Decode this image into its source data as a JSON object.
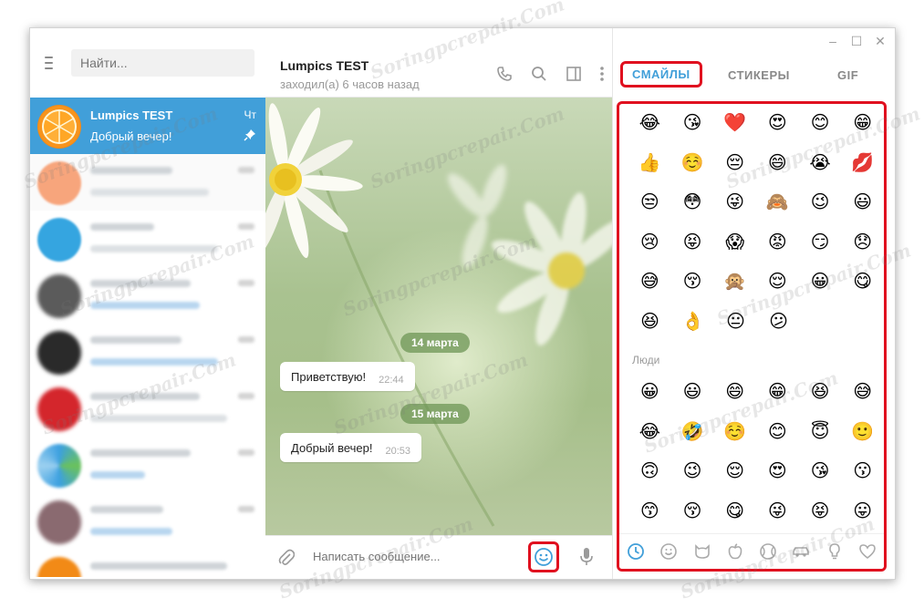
{
  "window": {
    "controls": [
      "–",
      "☐",
      "✕"
    ]
  },
  "sidebar": {
    "search_placeholder": "Найти...",
    "active_chat": {
      "name": "Lumpics TEST",
      "last_message": "Добрый вечер!",
      "time": "Чт"
    },
    "blurred_count": 7
  },
  "chat": {
    "title": "Lumpics TEST",
    "subtitle": "заходил(а) 6 часов назад",
    "messages": [
      {
        "date": "14 марта",
        "text": "Приветствую!",
        "time": "22:44"
      },
      {
        "date": "15 марта",
        "text": "Добрый вечер!",
        "time": "20:53"
      }
    ],
    "composer_placeholder": "Написать сообщение..."
  },
  "panel": {
    "tabs": [
      "СМАЙЛЫ",
      "СТИКЕРЫ",
      "GIF"
    ],
    "active_tab": "СМАЙЛЫ",
    "section_people": "Люди",
    "rows_top": [
      [
        "😂",
        "😘",
        "❤️",
        "😍",
        "😊",
        "😁"
      ],
      [
        "👍",
        "☺️",
        "😔",
        "😄",
        "😭",
        "💋"
      ],
      [
        "😒",
        "😳",
        "😜",
        "🙈",
        "😉",
        "😃"
      ],
      [
        "😢",
        "😝",
        "😱",
        "😡",
        "😏",
        "😞"
      ],
      [
        "😅",
        "😚",
        "🙊",
        "😌",
        "😀",
        "😋"
      ],
      [
        "😆",
        "👌",
        "😐",
        "😕"
      ]
    ],
    "rows_people": [
      [
        "😀",
        "😃",
        "😄",
        "😁",
        "😆",
        "😅"
      ],
      [
        "😂",
        "🤣",
        "☺️",
        "😊",
        "😇",
        "🙂"
      ],
      [
        "🙃",
        "😉",
        "😌",
        "😍",
        "😘",
        "😗"
      ],
      [
        "😙",
        "😚",
        "😋",
        "😜",
        "😝",
        "😛"
      ]
    ]
  },
  "watermark": "Soringpcrepair.Com"
}
